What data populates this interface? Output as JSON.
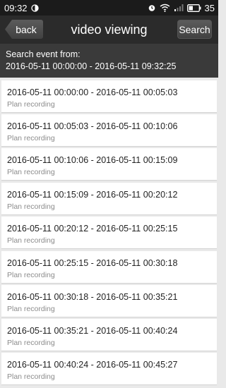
{
  "status_bar": {
    "time": "09:32",
    "battery": "35",
    "icons": [
      "clock-half-icon",
      "alarm-icon",
      "wifi-icon",
      "signal-icon",
      "battery-icon"
    ]
  },
  "nav": {
    "back_label": "back",
    "title": "video viewing",
    "search_label": "Search"
  },
  "filter": {
    "label": "Search event from:",
    "range": "2016-05-11 00:00:00 - 2016-05-11 09:32:25"
  },
  "events": [
    {
      "range": "2016-05-11 00:00:00 - 2016-05-11 00:05:03",
      "type": "Plan recording"
    },
    {
      "range": "2016-05-11 00:05:03 - 2016-05-11 00:10:06",
      "type": "Plan recording"
    },
    {
      "range": "2016-05-11 00:10:06 - 2016-05-11 00:15:09",
      "type": "Plan recording"
    },
    {
      "range": "2016-05-11 00:15:09 - 2016-05-11 00:20:12",
      "type": "Plan recording"
    },
    {
      "range": "2016-05-11 00:20:12 - 2016-05-11 00:25:15",
      "type": "Plan recording"
    },
    {
      "range": "2016-05-11 00:25:15 - 2016-05-11 00:30:18",
      "type": "Plan recording"
    },
    {
      "range": "2016-05-11 00:30:18 - 2016-05-11 00:35:21",
      "type": "Plan recording"
    },
    {
      "range": "2016-05-11 00:35:21 - 2016-05-11 00:40:24",
      "type": "Plan recording"
    },
    {
      "range": "2016-05-11 00:40:24 - 2016-05-11 00:45:27",
      "type": "Plan recording"
    }
  ]
}
